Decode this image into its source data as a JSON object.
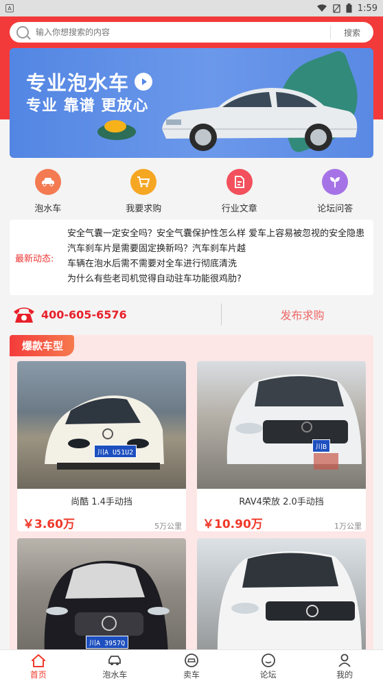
{
  "status_bar": {
    "time": "1:59",
    "left_badge": "A"
  },
  "search": {
    "placeholder": "输入你想搜索的内容",
    "button_label": "搜索"
  },
  "banner": {
    "title": "专业泡水车",
    "subtitle": "专业 靠谱 更放心"
  },
  "quick_menu": [
    {
      "label": "泡水车",
      "icon": "car-icon",
      "color": "#f47a51"
    },
    {
      "label": "我要求购",
      "icon": "cart-icon",
      "color": "#f5a623"
    },
    {
      "label": "行业文章",
      "icon": "document-icon",
      "color": "#f2505c"
    },
    {
      "label": "论坛问答",
      "icon": "sprout-icon",
      "color": "#a673e6"
    }
  ],
  "news": {
    "label": "最新动态:",
    "items": [
      "安全气囊一定安全吗？安全气囊保护性怎么样 爱车上容易被忽视的安全隐患",
      "汽车刹车片是需要固定换新吗？汽车刹车片越",
      "车辆在泡水后需不需要对全车进行彻底清洗",
      "为什么有些老司机觉得自动驻车功能很鸡肋?"
    ]
  },
  "contact": {
    "phone": "400-605-6576",
    "publish_label": "发布求购"
  },
  "hot_section": {
    "title": "爆款车型",
    "cars": [
      {
        "name": "尚酷 1.4手动挡",
        "price": "￥3.60万",
        "mileage": "5万公里",
        "color": "#f3f0e6",
        "plate": "川A U51U2"
      },
      {
        "name": "RAV4荣放 2.0手动挡",
        "price": "￥10.90万",
        "mileage": "1万公里",
        "color": "#eef0f1",
        "plate": "川B"
      },
      {
        "name": "",
        "price": "",
        "mileage": "",
        "color": "#1c1c22",
        "plate": "川A 3957Q"
      },
      {
        "name": "",
        "price": "",
        "mileage": "",
        "color": "#f4f4f4",
        "plate": ""
      }
    ]
  },
  "tabs": [
    {
      "label": "首页",
      "icon": "home-icon",
      "active": true
    },
    {
      "label": "泡水车",
      "icon": "car-icon",
      "active": false
    },
    {
      "label": "卖车",
      "icon": "sell-car-icon",
      "active": false
    },
    {
      "label": "论坛",
      "icon": "forum-icon",
      "active": false
    },
    {
      "label": "我的",
      "icon": "user-icon",
      "active": false
    }
  ],
  "colors": {
    "brand_red": "#f33a3a",
    "price_red": "#f0382a",
    "banner_blue": "#5386e3"
  }
}
